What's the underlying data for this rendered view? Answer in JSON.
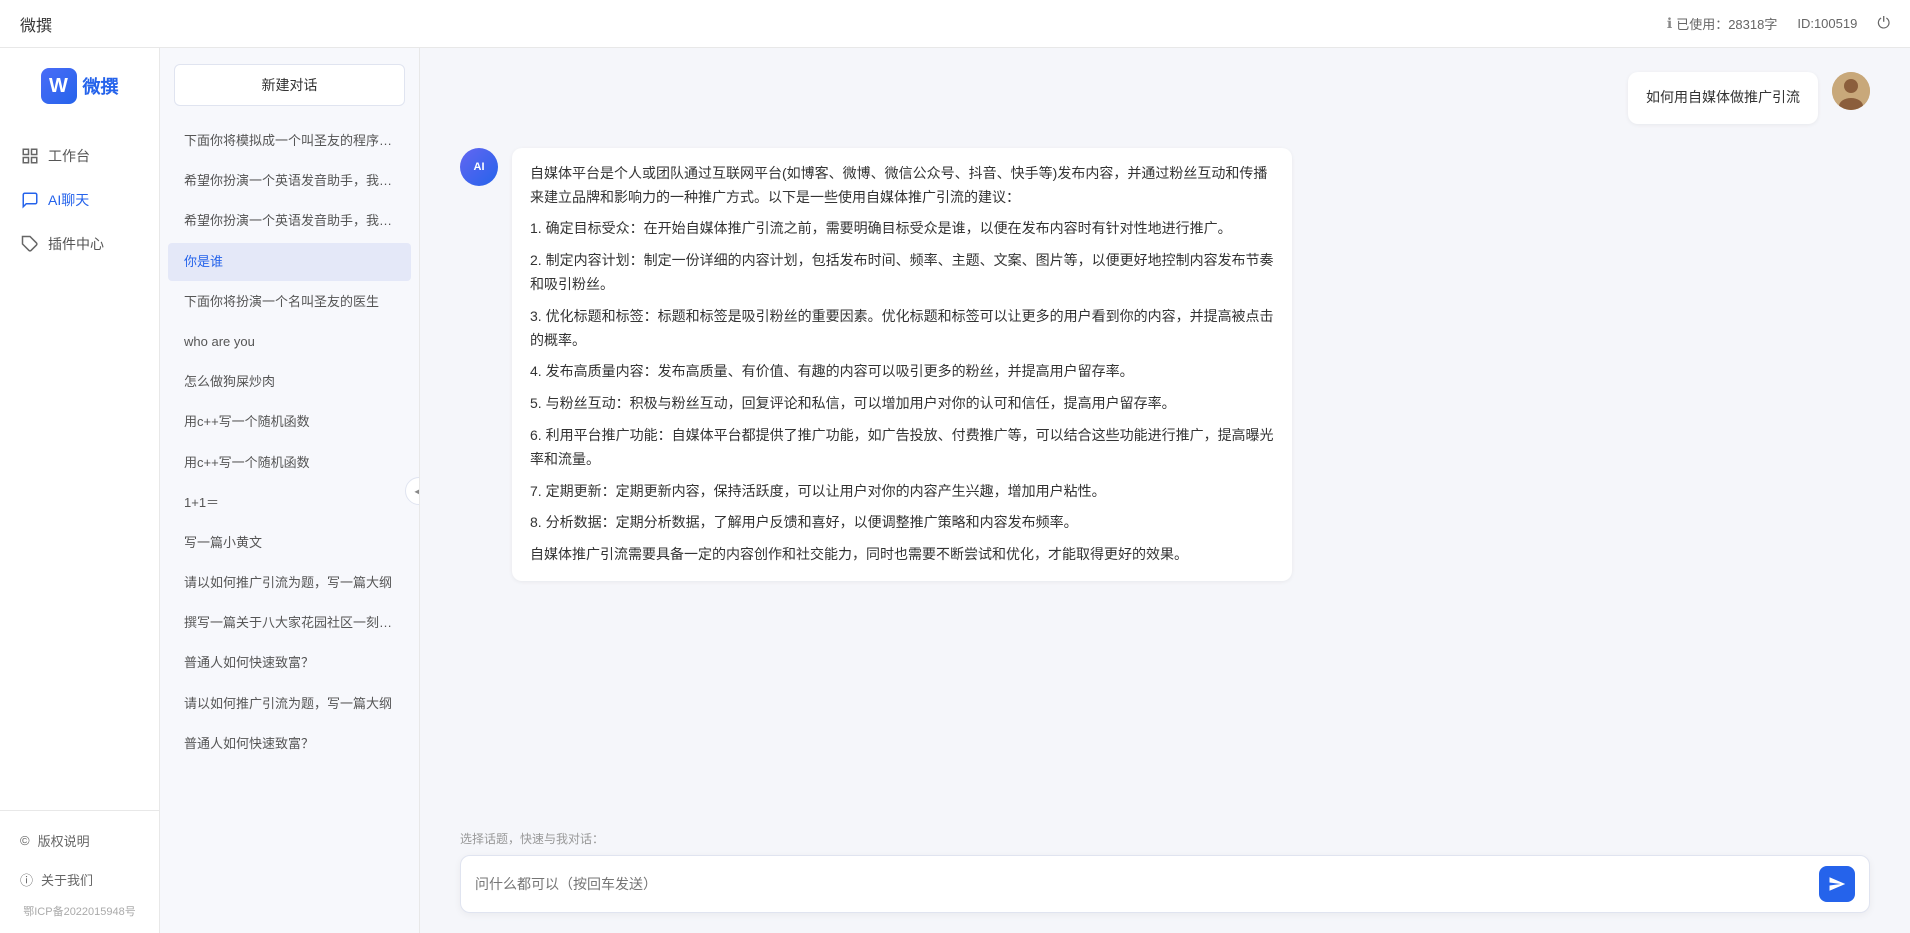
{
  "topbar": {
    "title": "微撰",
    "usage_label": "已使用：28318字",
    "usage_icon": "info-icon",
    "id_label": "ID:100519",
    "logout_icon": "logout-icon"
  },
  "sidebar": {
    "logo_text": "微撰",
    "nav_items": [
      {
        "id": "workbench",
        "label": "工作台",
        "icon": "grid-icon"
      },
      {
        "id": "ai-chat",
        "label": "AI聊天",
        "icon": "chat-icon",
        "active": true
      },
      {
        "id": "plugin-center",
        "label": "插件中心",
        "icon": "plugin-icon"
      }
    ],
    "footer_items": [
      {
        "id": "copyright",
        "label": "版权说明",
        "icon": "copyright-icon"
      },
      {
        "id": "about",
        "label": "关于我们",
        "icon": "info-circle-icon"
      }
    ],
    "icp": "鄂ICP备2022015948号"
  },
  "conv_list": {
    "new_btn": "新建对话",
    "items": [
      {
        "id": "c1",
        "text": "下面你将模拟成一个叫圣友的程序员，我说..."
      },
      {
        "id": "c2",
        "text": "希望你扮演一个英语发音助手，我提供给你..."
      },
      {
        "id": "c3",
        "text": "希望你扮演一个英语发音助手，我提供给你..."
      },
      {
        "id": "c4",
        "text": "你是谁",
        "active": true
      },
      {
        "id": "c5",
        "text": "下面你将扮演一个名叫圣友的医生"
      },
      {
        "id": "c6",
        "text": "who are you"
      },
      {
        "id": "c7",
        "text": "怎么做狗屎炒肉"
      },
      {
        "id": "c8",
        "text": "用c++写一个随机函数"
      },
      {
        "id": "c9",
        "text": "用c++写一个随机函数"
      },
      {
        "id": "c10",
        "text": "1+1＝"
      },
      {
        "id": "c11",
        "text": "写一篇小黄文"
      },
      {
        "id": "c12",
        "text": "请以如何推广引流为题，写一篇大纲"
      },
      {
        "id": "c13",
        "text": "撰写一篇关于八大家花园社区一刻钟便民生..."
      },
      {
        "id": "c14",
        "text": "普通人如何快速致富？"
      },
      {
        "id": "c15",
        "text": "请以如何推广引流为题，写一篇大纲"
      },
      {
        "id": "c16",
        "text": "普通人如何快速致富？"
      }
    ]
  },
  "chat": {
    "user_message": "如何用自媒体做推广引流",
    "ai_response": {
      "paragraphs": [
        "自媒体平台是个人或团队通过互联网平台(如博客、微博、微信公众号、抖音、快手等)发布内容，并通过粉丝互动和传播来建立品牌和影响力的一种推广方式。以下是一些使用自媒体推广引流的建议：",
        "1. 确定目标受众：在开始自媒体推广引流之前，需要明确目标受众是谁，以便在发布内容时有针对性地进行推广。",
        "2. 制定内容计划：制定一份详细的内容计划，包括发布时间、频率、主题、文案、图片等，以便更好地控制内容发布节奏和吸引粉丝。",
        "3. 优化标题和标签：标题和标签是吸引粉丝的重要因素。优化标题和标签可以让更多的用户看到你的内容，并提高被点击的概率。",
        "4. 发布高质量内容：发布高质量、有价值、有趣的内容可以吸引更多的粉丝，并提高用户留存率。",
        "5. 与粉丝互动：积极与粉丝互动，回复评论和私信，可以增加用户对你的认可和信任，提高用户留存率。",
        "6. 利用平台推广功能：自媒体平台都提供了推广功能，如广告投放、付费推广等，可以结合这些功能进行推广，提高曝光率和流量。",
        "7. 定期更新：定期更新内容，保持活跃度，可以让用户对你的内容产生兴趣，增加用户粘性。",
        "8. 分析数据：定期分析数据，了解用户反馈和喜好，以便调整推广策略和内容发布频率。",
        "自媒体推广引流需要具备一定的内容创作和社交能力，同时也需要不断尝试和优化，才能取得更好的效果。"
      ]
    },
    "input_placeholder": "问什么都可以（按回车发送）",
    "quick_topics_label": "选择话题，快速与我对话："
  }
}
